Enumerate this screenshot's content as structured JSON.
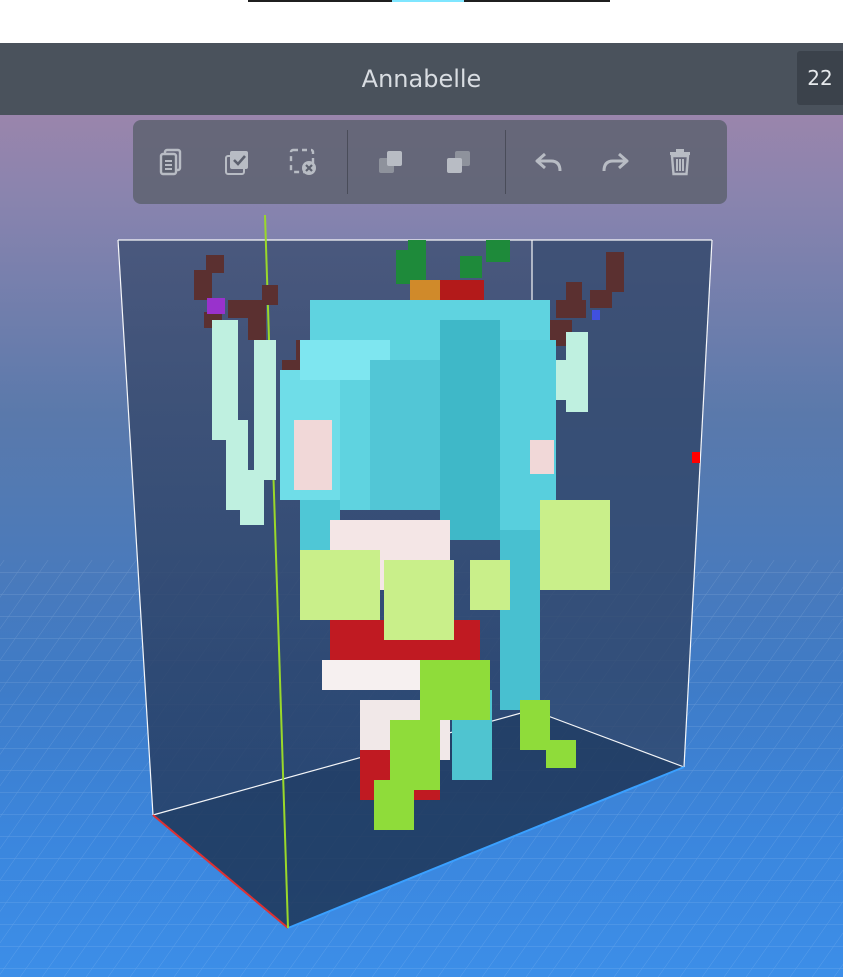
{
  "progress": {
    "fraction": 0.2
  },
  "title_bar": {
    "title": "Annabelle",
    "frame_count": "22"
  },
  "toolbar": {
    "buttons": [
      {
        "name": "copy",
        "icon": "copy-icon"
      },
      {
        "name": "select-all",
        "icon": "select-all-icon"
      },
      {
        "name": "deselect",
        "icon": "deselect-icon"
      },
      {
        "name": "bring-forward",
        "icon": "bring-forward-icon"
      },
      {
        "name": "send-backward",
        "icon": "send-backward-icon"
      },
      {
        "name": "undo",
        "icon": "undo-icon"
      },
      {
        "name": "redo",
        "icon": "redo-icon"
      },
      {
        "name": "delete",
        "icon": "trash-icon"
      }
    ]
  },
  "colors": {
    "accent": "#7fe6ff",
    "title_bar": "#4a525c",
    "hair": "#5fd3e0",
    "hair_dark": "#3fb8c8",
    "antler": "#5b3030",
    "wing": "#bff0e0",
    "leaf": "#a7e46a",
    "dress_red": "#c01a22",
    "skin": "#f1d8d8",
    "axis_x": "#e03030",
    "axis_y": "#9ad82a",
    "axis_z": "#3aa0ff"
  }
}
